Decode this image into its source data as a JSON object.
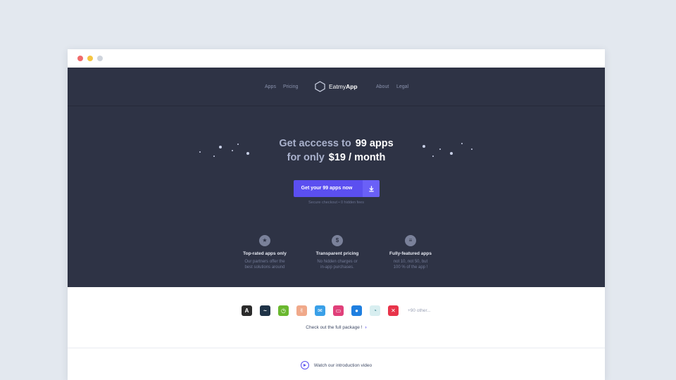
{
  "nav": {
    "left_links": [
      "Apps",
      "Pricing"
    ],
    "brand": {
      "part1": "Eatmy",
      "part2": "App"
    },
    "right_links": [
      "About",
      "Legal"
    ]
  },
  "hero": {
    "line1_muted": "Get acccess to",
    "line1_strong": "99 apps",
    "line2_muted": "for only",
    "line2_strong": "$19 / month",
    "cta_label": "Get your 99 apps now",
    "secure_note": "Secure checkout  •  0 hidden fees"
  },
  "features": [
    {
      "icon": "star-icon",
      "glyph": "★",
      "title": "Top-rated apps only",
      "desc_1": "Our partners offer the",
      "desc_2": "best solutions around"
    },
    {
      "icon": "dollar-icon",
      "glyph": "$",
      "title": "Transparent pricing",
      "desc_1": "No hidden charges or",
      "desc_2": "in-app purchases."
    },
    {
      "icon": "list-check-icon",
      "glyph": "≡",
      "title": "Fully-featured apps",
      "desc_1": "not 10, not 50, but",
      "desc_2": "100 % of the app !"
    }
  ],
  "apps": {
    "icons": [
      {
        "name": "font-app-icon",
        "color": "#2b2b2b",
        "glyph": "A"
      },
      {
        "name": "wave-app-icon",
        "color": "#1f3347",
        "glyph": "~"
      },
      {
        "name": "clock-app-icon",
        "color": "#6ab82f",
        "glyph": "◷"
      },
      {
        "name": "hand-app-icon",
        "color": "#f0a98a",
        "glyph": "✌"
      },
      {
        "name": "chat-app-icon",
        "color": "#3aa0e8",
        "glyph": "✉"
      },
      {
        "name": "monitor-app-icon",
        "color": "#e0407a",
        "glyph": "▭"
      },
      {
        "name": "drop-app-icon",
        "color": "#1f7fe0",
        "glyph": "●"
      },
      {
        "name": "gauge-app-icon",
        "color": "#d8eef0",
        "glyph": "◔"
      },
      {
        "name": "x-app-icon",
        "color": "#e8344a",
        "glyph": "✕"
      }
    ],
    "more_label": "+90 other...",
    "full_link": "Check out the full package !"
  },
  "video": {
    "label": "Watch our introduction video"
  },
  "colors": {
    "hero_bg": "#2e3345",
    "accent": "#5b4ff0",
    "page_bg": "#e3e8ef"
  }
}
